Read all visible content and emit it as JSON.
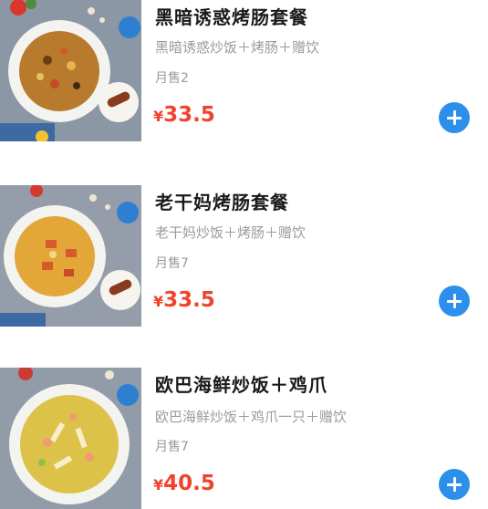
{
  "currency_symbol": "¥",
  "colors": {
    "price": "#f0432b",
    "add_button": "#2c8fec"
  },
  "items": [
    {
      "name": "黑暗诱惑烤肠套餐",
      "description": "黑暗诱惑炒饭＋烤肠＋赠饮",
      "monthly_sales": "月售2",
      "price": "33.5",
      "add_icon": "plus-icon"
    },
    {
      "name": "老干妈烤肠套餐",
      "description": "老干妈炒饭＋烤肠＋赠饮",
      "monthly_sales": "月售7",
      "price": "33.5",
      "add_icon": "plus-icon"
    },
    {
      "name": "欧巴海鲜炒饭＋鸡爪",
      "description": "欧巴海鲜炒饭＋鸡爪一只＋赠饮",
      "monthly_sales": "月售7",
      "price": "40.5",
      "add_icon": "plus-icon"
    }
  ]
}
